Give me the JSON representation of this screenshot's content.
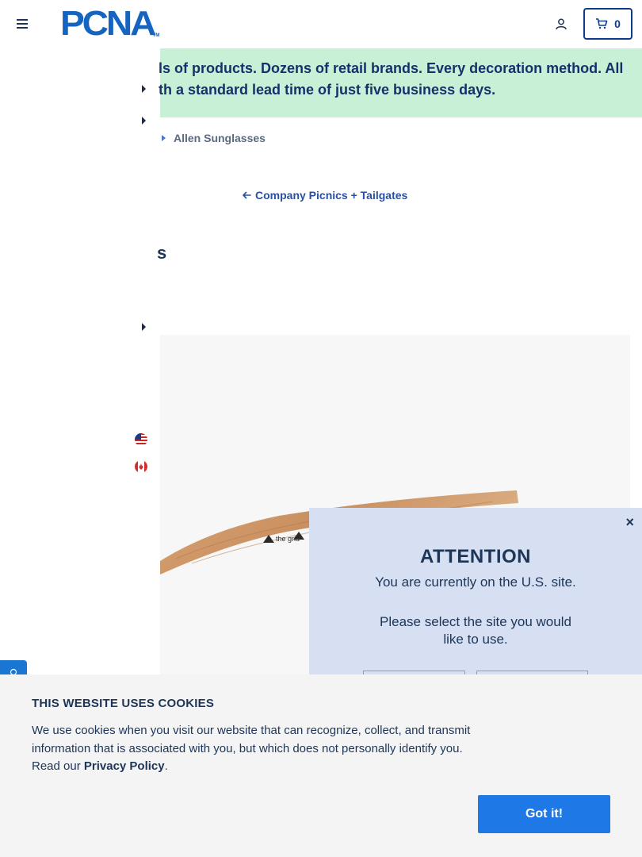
{
  "header": {
    "logo_text": "PCNA",
    "logo_tm": "TM",
    "cart_count": "0"
  },
  "banner": {
    "line1": "ls of products. Dozens of retail brands. Every decoration method. All",
    "line2": "th a standard lead time of just five business days."
  },
  "breadcrumb": {
    "current": "Allen Sunglasses"
  },
  "back_link": {
    "label": "Company Picnics + Tailgates"
  },
  "product": {
    "title_fragment": "s",
    "imprint": "the grid"
  },
  "modal": {
    "close": "×",
    "title": "ATTENTION",
    "line1": "You are currently on the U.S. site.",
    "line2": "Please select the site you would like to use."
  },
  "cookie": {
    "title": "THIS WEBSITE USES COOKIES",
    "body": "We use cookies when you visit our website that can recognize, collect, and transmit information that is associated with you, but which does not personally identify you. Read our ",
    "link": "Privacy Policy",
    "end": ".",
    "button": "Got it!"
  },
  "colors": {
    "brand_blue": "#1565c0",
    "navy": "#1d3557",
    "banner_green": "#c8f0d6",
    "modal_bg": "#d6e0f2",
    "button_blue": "#1e78e6"
  }
}
